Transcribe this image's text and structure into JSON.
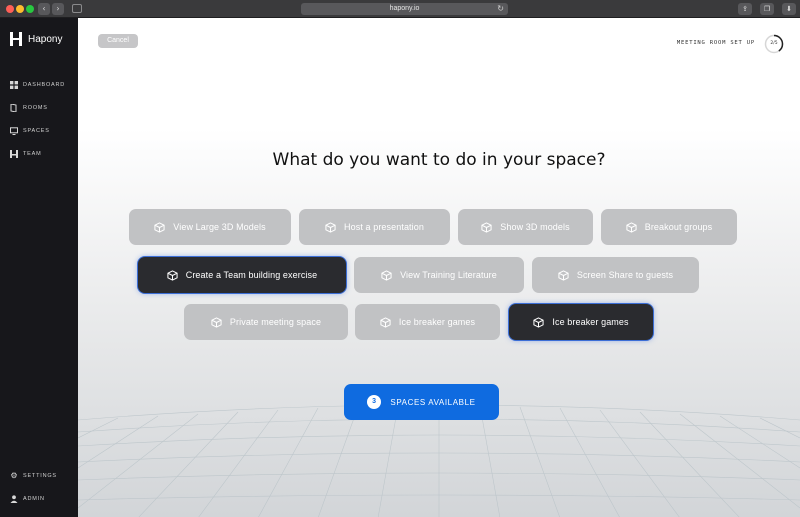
{
  "browser": {
    "url": "hapony.io"
  },
  "sidebar": {
    "brand": "Hapony",
    "items": [
      {
        "label": "DASHBOARD",
        "icon": "grid-icon"
      },
      {
        "label": "ROOMS",
        "icon": "door-icon"
      },
      {
        "label": "SPACES",
        "icon": "monitor-icon"
      },
      {
        "label": "TEAM",
        "icon": "team-icon"
      }
    ],
    "bottom_items": [
      {
        "label": "SETTINGS",
        "icon": "gear-icon"
      },
      {
        "label": "ADMIN",
        "icon": "user-icon"
      }
    ]
  },
  "header": {
    "cancel_label": "Cancel",
    "setup_label": "MEETING ROOM SET UP",
    "progress_text": "2/5",
    "progress_fraction": 0.4
  },
  "main": {
    "question": "What do you want to do in your space?",
    "options": [
      {
        "label": "View Large 3D Models",
        "selected": false
      },
      {
        "label": "Host a presentation",
        "selected": false
      },
      {
        "label": "Show 3D models",
        "selected": false
      },
      {
        "label": "Breakout groups",
        "selected": false
      },
      {
        "label": "Create a Team building exercise",
        "selected": true
      },
      {
        "label": "View Training Literature",
        "selected": false
      },
      {
        "label": "Screen Share to guests",
        "selected": false
      },
      {
        "label": "Private meeting space",
        "selected": false
      },
      {
        "label": "Ice breaker games",
        "selected": false
      },
      {
        "label": "Ice breaker games",
        "selected": true
      }
    ],
    "spaces_count": "3",
    "spaces_label": "SPACES AVAILABLE"
  },
  "colors": {
    "accent": "#0f6be0",
    "selected": "#2a2b2f",
    "option": "#c1c2c4",
    "sidebar": "#17171b"
  }
}
